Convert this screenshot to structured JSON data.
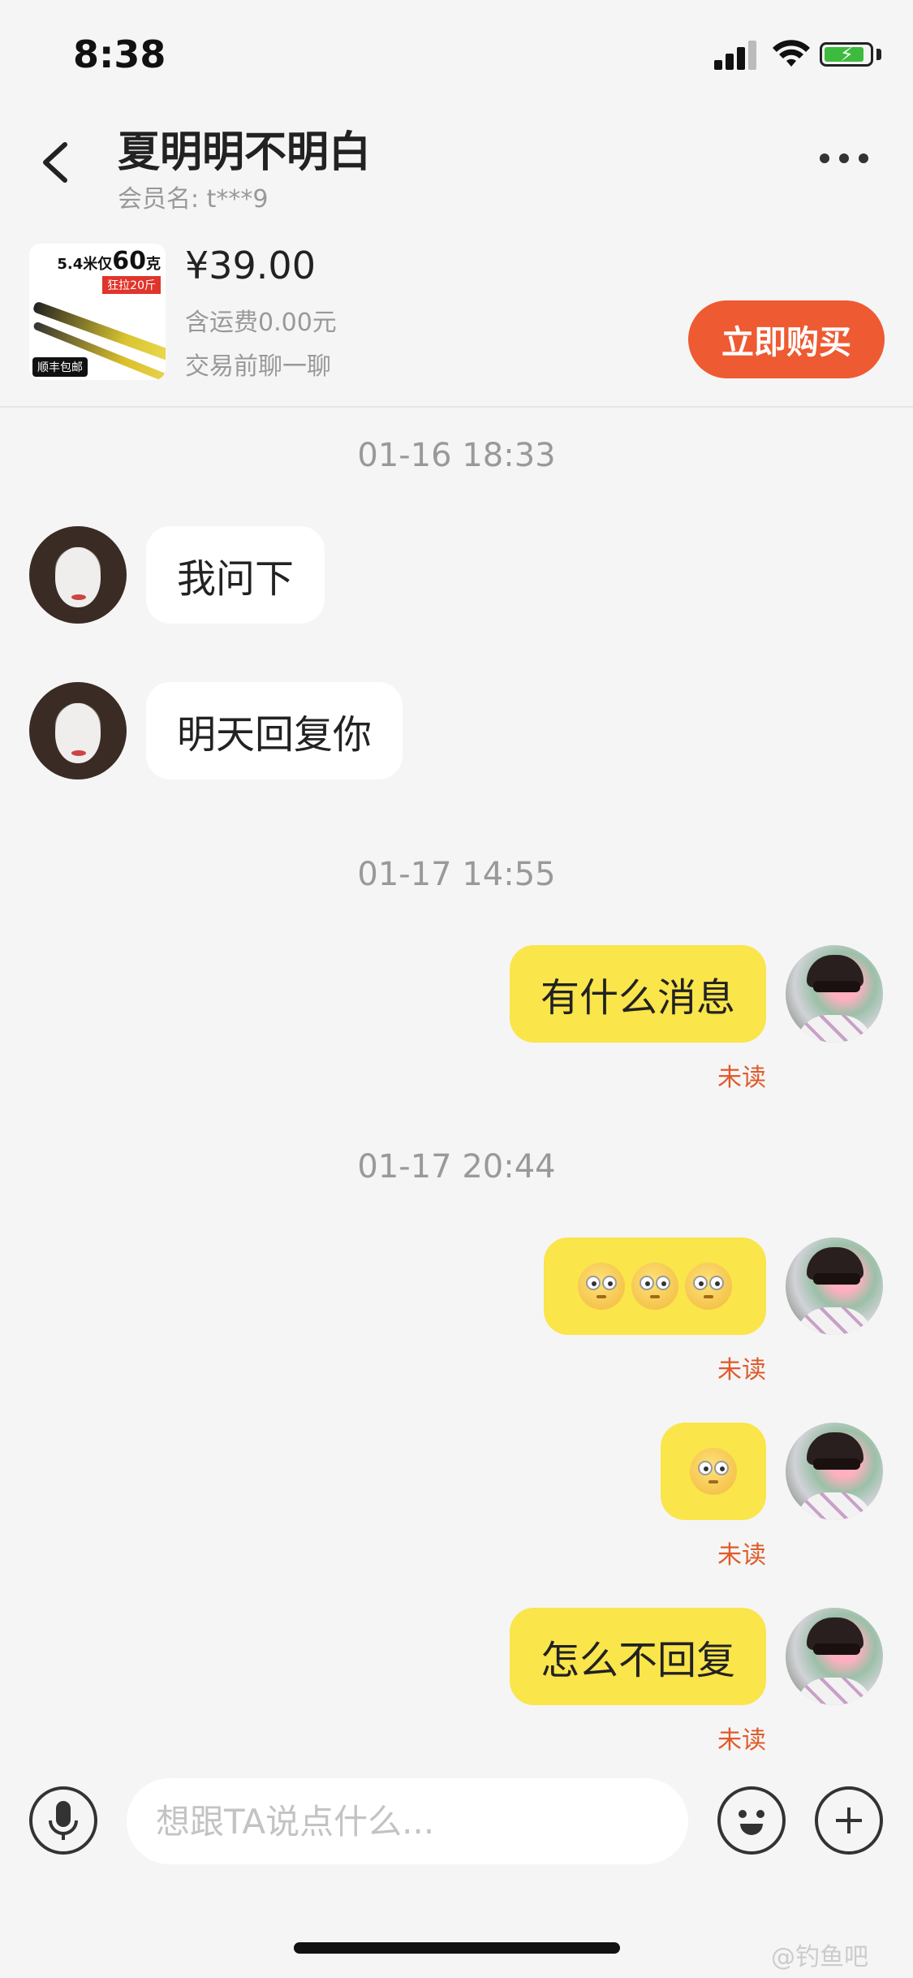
{
  "status_bar": {
    "time": "8:38"
  },
  "header": {
    "title": "夏明明不明白",
    "member_label": "会员名: t***9"
  },
  "product": {
    "thumb_tagline_prefix": "5.4米仅",
    "thumb_tagline_num": "60",
    "thumb_tagline_suffix": "克",
    "thumb_redtag": "狂拉20斤",
    "thumb_badge": "顺丰包邮",
    "price": "¥39.00",
    "shipping": "含运费0.00元",
    "hint": "交易前聊一聊",
    "buy_label": "立即购买"
  },
  "messages": {
    "ts1": "01-16 18:33",
    "m1": "我问下",
    "m2": "明天回复你",
    "ts2": "01-17 14:55",
    "m3": "有什么消息",
    "m3_status": "未读",
    "ts3": "01-17 20:44",
    "m4_status": "未读",
    "m5_status": "未读",
    "m6": "怎么不回复",
    "m6_status": "未读"
  },
  "input": {
    "placeholder": "想跟TA说点什么..."
  },
  "watermark": "@钓鱼吧",
  "icons": {
    "back": "chevron-left-icon",
    "more": "more-dots-icon",
    "mic": "microphone-icon",
    "emoji": "smiley-icon",
    "plus": "plus-icon"
  },
  "colors": {
    "accent": "#ee5a31",
    "bubble_out": "#fae54b",
    "unread": "#e05a2a"
  }
}
